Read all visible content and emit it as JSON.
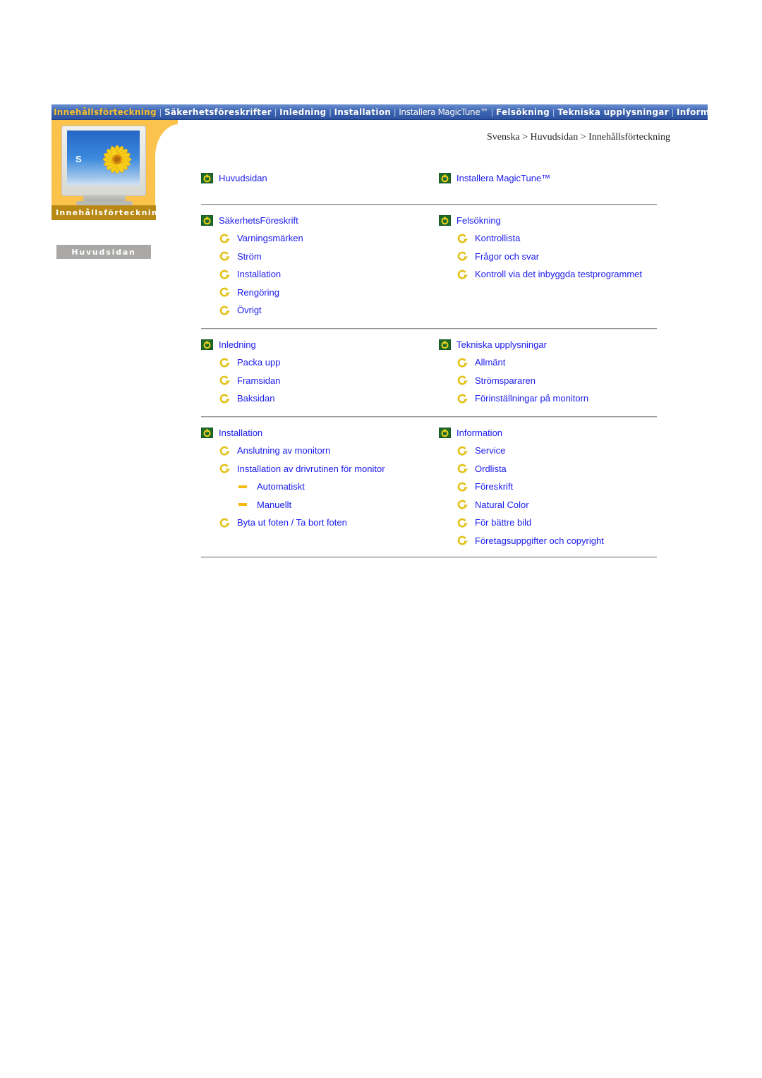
{
  "nav": {
    "items": [
      {
        "label": "Innehållsförteckning",
        "active": true
      },
      {
        "label": "Säkerhetsföreskrifter",
        "active": false
      },
      {
        "label": "Inledning",
        "active": false
      },
      {
        "label": "Installation",
        "active": false
      },
      {
        "label": "Installera MagicTune™",
        "active": false
      },
      {
        "label": "Felsökning",
        "active": false
      },
      {
        "label": "Tekniska upplysningar",
        "active": false
      },
      {
        "label": "Information",
        "active": false
      }
    ],
    "separator": "|",
    "active_color": "#f7c032"
  },
  "sidebar": {
    "banner_label": "Innehållsförteckning",
    "monitor_letter": "S",
    "home_button": "Huvudsidan"
  },
  "breadcrumb": {
    "text": "Svenska > Huvudsidan > Innehållsförteckning"
  },
  "colors": {
    "link": "#1a1aee",
    "nav_blue": "#3f67b4",
    "banner_orange": "#fbc34c",
    "bullet_green": "#1f6b2a",
    "bullet_yellow": "#f5b90f"
  },
  "sections": [
    {
      "left": {
        "title": "Huvudsidan",
        "items": []
      },
      "right": {
        "title": "Installera MagicTune™",
        "items": []
      }
    },
    {
      "left": {
        "title": "SäkerhetsFöreskrift",
        "items": [
          {
            "label": "Varningsmärken"
          },
          {
            "label": "Ström"
          },
          {
            "label": "Installation"
          },
          {
            "label": "Rengöring"
          },
          {
            "label": "Övrigt"
          }
        ]
      },
      "right": {
        "title": "Felsökning",
        "items": [
          {
            "label": "Kontrollista"
          },
          {
            "label": "Frågor och svar"
          },
          {
            "label": "Kontroll via det inbyggda testprogrammet"
          }
        ]
      }
    },
    {
      "left": {
        "title": "Inledning",
        "items": [
          {
            "label": "Packa upp"
          },
          {
            "label": "Framsidan"
          },
          {
            "label": "Baksidan"
          }
        ]
      },
      "right": {
        "title": "Tekniska upplysningar",
        "items": [
          {
            "label": "Allmänt"
          },
          {
            "label": "Strömspararen"
          },
          {
            "label": "Förinställningar på monitorn"
          }
        ]
      }
    },
    {
      "left": {
        "title": "Installation",
        "items": [
          {
            "label": "Anslutning av monitorn"
          },
          {
            "label": "Installation av drivrutinen för monitor"
          },
          {
            "label": "Automatiskt",
            "sub": true
          },
          {
            "label": "Manuellt",
            "sub": true
          },
          {
            "label": "Byta ut foten / Ta bort foten"
          }
        ]
      },
      "right": {
        "title": "Information",
        "items": [
          {
            "label": "Service"
          },
          {
            "label": "Ordlista"
          },
          {
            "label": "Föreskrift"
          },
          {
            "label": "Natural Color"
          },
          {
            "label": "För bättre bild"
          },
          {
            "label": "Företagsuppgifter och copyright"
          }
        ]
      }
    }
  ]
}
